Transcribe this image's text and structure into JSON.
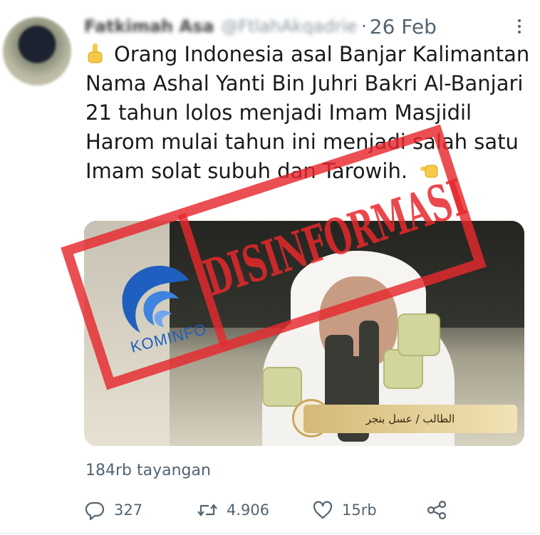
{
  "tweet": {
    "author_name": "Fatkimah Asa",
    "author_handle": "@FtlahAkqadrie",
    "separator": "·",
    "date": "26 Feb",
    "text": "Orang Indonesia asal Banjar Kalimantan Nama Ashal Yanti Bin Juhri Bakri Al-Banjari 21 tahun lolos menjadi Imam Masjidil Harom mulai tahun ini menjadi salah satu Imam solat subuh dan Tarowih.",
    "views": "184rb tayangan"
  },
  "media": {
    "caption": "الطالب / عسل بنجر",
    "logo_text": "KOMINFO",
    "stamp_text": "DISINFORMASI"
  },
  "actions": {
    "replies": "327",
    "retweets": "4.906",
    "likes": "15rb"
  },
  "colors": {
    "stamp": "#e6282d",
    "text_secondary": "#536471",
    "kominfo_blue": "#1f5fbf"
  },
  "icons": [
    "point-up-emoji",
    "point-left-emoji",
    "more-icon",
    "reply-icon",
    "retweet-icon",
    "like-icon",
    "share-icon"
  ]
}
